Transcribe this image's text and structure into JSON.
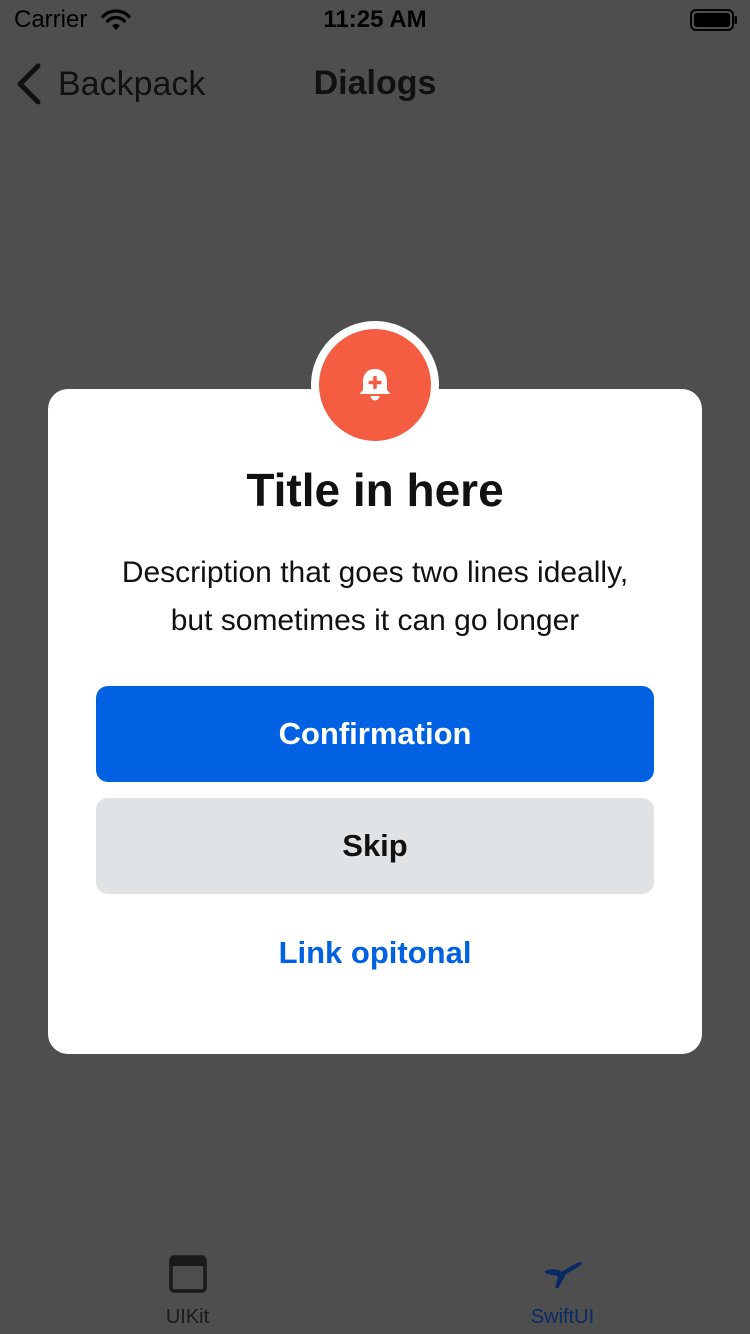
{
  "status_bar": {
    "carrier": "Carrier",
    "time": "11:25 AM"
  },
  "nav": {
    "back_label": "Backpack",
    "title": "Dialogs"
  },
  "dialog": {
    "icon": "bell-plus-icon",
    "title": "Title in here",
    "description_line1": "Description that goes two lines ideally,",
    "description_line2": "but sometimes it can go longer",
    "primary_button": "Confirmation",
    "secondary_button": "Skip",
    "link": "Link opitonal"
  },
  "tab_bar": {
    "items": [
      {
        "label": "UIKit",
        "icon": "window-icon",
        "selected": false
      },
      {
        "label": "SwiftUI",
        "icon": "swift-icon",
        "selected": true
      }
    ]
  },
  "colors": {
    "overlay_background": "#4e4e4e",
    "dialog_background": "#ffffff",
    "badge": "#f55d42",
    "primary": "#0062e3",
    "secondary": "#e0e3e5",
    "tab_selected": "#0a2a66"
  }
}
